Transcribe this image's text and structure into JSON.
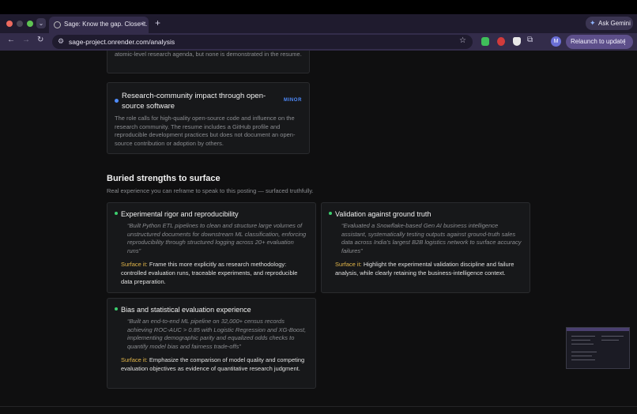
{
  "browser": {
    "tab_title": "Sage: Know the gap. Close it.",
    "tab_close": "×",
    "new_tab": "+",
    "tab_menu": "⌄",
    "ask_gemini": "Ask Gemini",
    "url": "sage-project.onrender.com/analysis",
    "avatar_initial": "M",
    "relaunch": "Relaunch to update",
    "icons": [
      "back-arrow-icon",
      "forward-arrow-icon",
      "reload-icon",
      "site-settings-icon",
      "bookmark-star-icon",
      "extension-icon",
      "puzzle-icon",
      "kebab-menu-icon",
      "gemini-sparkle-icon"
    ]
  },
  "gaps": {
    "partial_text": "atomic-level research agenda, but none is demonstrated in the resume.",
    "items": [
      {
        "title": "Research-community impact through open-source software",
        "severity": "MINOR",
        "severity_color": "#4f8cff",
        "description": "The role calls for high-quality open-source code and influence on the research community. The resume includes a GitHub profile and reproducible development practices but does not document an open-source contribution or adoption by others."
      }
    ]
  },
  "strengths": {
    "title": "Buried strengths to surface",
    "subtitle": "Real experience you can reframe to speak to this posting — surfaced truthfully.",
    "surface_label": "Surface it:",
    "items": [
      {
        "title": "Experimental rigor and reproducibility",
        "quote": "“Built Python ETL pipelines to clean and structure large volumes of unstructured documents for downstream ML classification, enforcing reproducibility through structured logging across 20+ evaluation runs”",
        "surface": "Frame this more explicitly as research methodology: controlled evaluation runs, traceable experiments, and reproducible data preparation."
      },
      {
        "title": "Validation against ground truth",
        "quote": "“Evaluated a Snowflake-based Gen AI business intelligence assistant, systematically testing outputs against ground-truth sales data across India’s largest B2B logistics network to surface accuracy failures”",
        "surface": "Highlight the experimental validation discipline and failure analysis, while clearly retaining the business-intelligence context."
      },
      {
        "title": "Bias and statistical evaluation experience",
        "quote": "“Built an end-to-end ML pipeline on 32,000+ census records achieving ROC-AUC > 0.85 with Logistic Regression and XG-Boost, implementing demographic parity and equalized odds checks to quantify model bias and fairness trade-offs”",
        "surface": "Emphasize the comparison of model quality and competing evaluation objectives as evidence of quantitative research judgment."
      }
    ],
    "accent_green": "#3ccf6e",
    "accent_gold": "#e2b64a"
  }
}
